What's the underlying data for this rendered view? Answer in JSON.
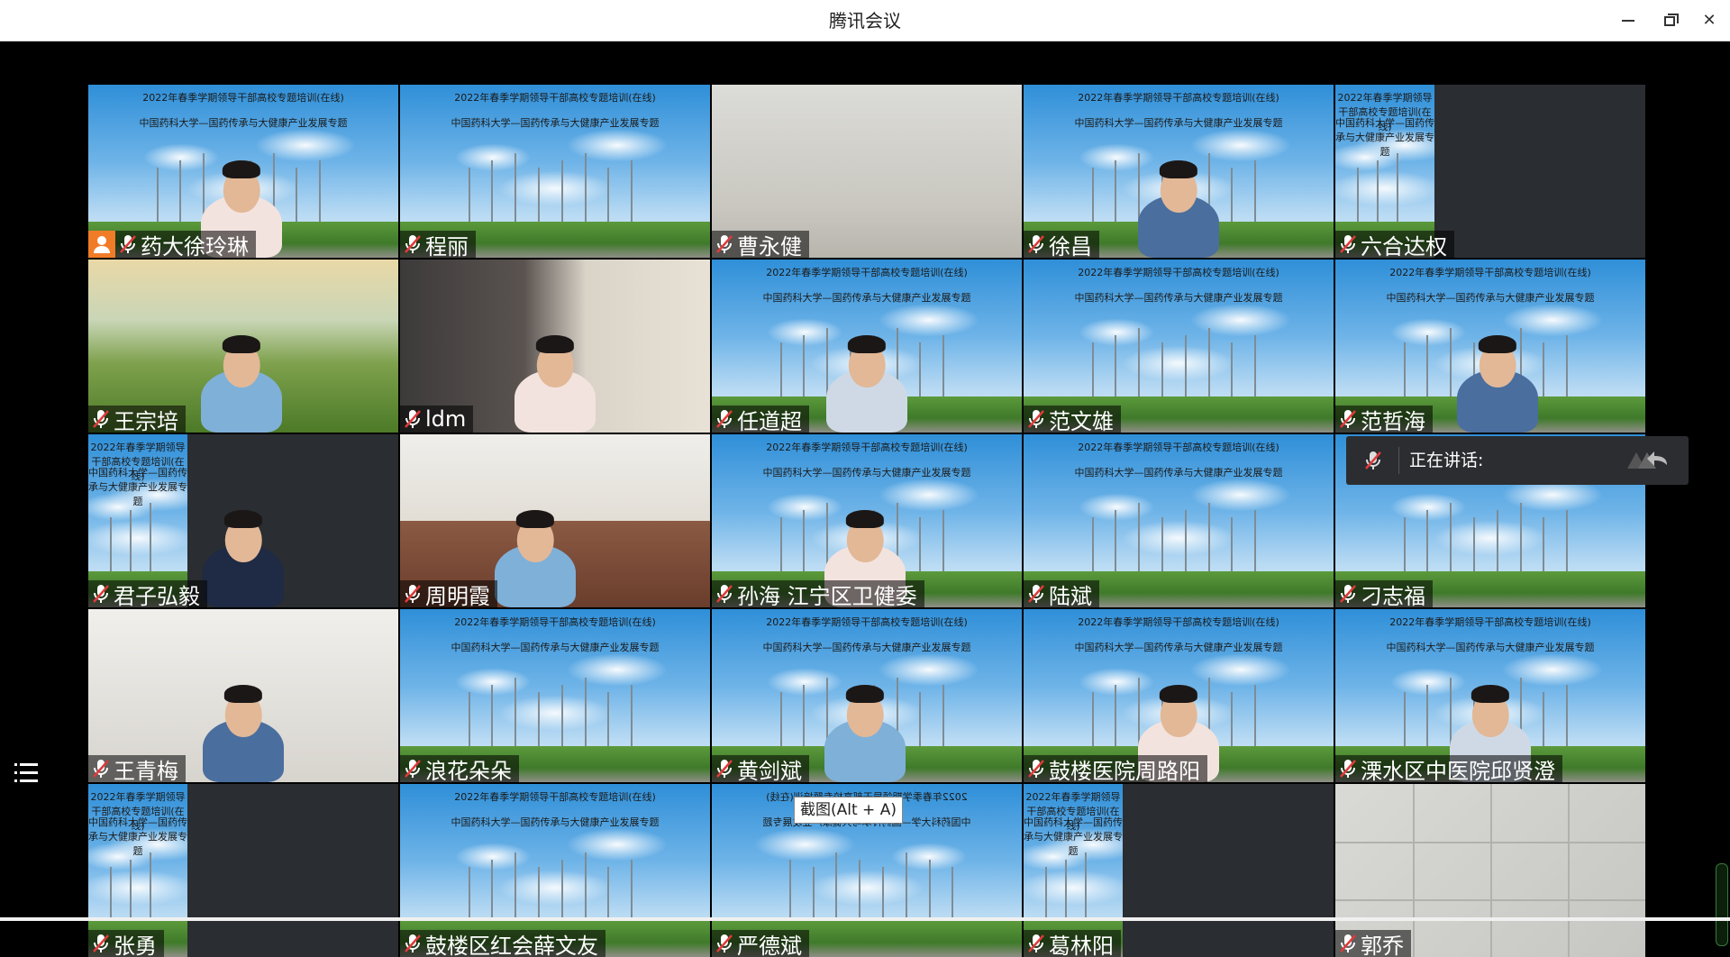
{
  "window": {
    "title": "腾讯会议"
  },
  "banner": {
    "line1": "2022年春季学期领导干部高校专题培训(在线)",
    "line2": "中国药科大学—国药传承与大健康产业发展专题"
  },
  "participants": [
    {
      "name": "药大徐玲琳",
      "host": true
    },
    {
      "name": "程丽"
    },
    {
      "name": "曹永健"
    },
    {
      "name": "徐昌"
    },
    {
      "name": "六合达权"
    },
    {
      "name": "王宗培"
    },
    {
      "name": "ldm"
    },
    {
      "name": "任道超"
    },
    {
      "name": "范文雄"
    },
    {
      "name": "范哲海"
    },
    {
      "name": "君子弘毅"
    },
    {
      "name": "周明霞"
    },
    {
      "name": "孙海 江宁区卫健委"
    },
    {
      "name": "陆斌"
    },
    {
      "name": "刁志福"
    },
    {
      "name": "王青梅"
    },
    {
      "name": "浪花朵朵"
    },
    {
      "name": "黄剑斌"
    },
    {
      "name": "鼓楼医院周路阳"
    },
    {
      "name": "溧水区中医院邱贤澄"
    },
    {
      "name": "张勇"
    },
    {
      "name": "鼓楼区红会薛文友"
    },
    {
      "name": "严德斌"
    },
    {
      "name": "葛林阳"
    },
    {
      "name": "郭乔"
    }
  ],
  "speaking": {
    "label": "正在讲话:"
  },
  "tooltip": {
    "text": "截图(Alt + A)"
  },
  "icons": {
    "mic_muted": "mic-muted-icon",
    "host": "host-icon",
    "list": "list-icon",
    "reply": "reply-icon"
  },
  "colors": {
    "host_badge": "#f07c28",
    "mute_red": "#e03a3a"
  }
}
